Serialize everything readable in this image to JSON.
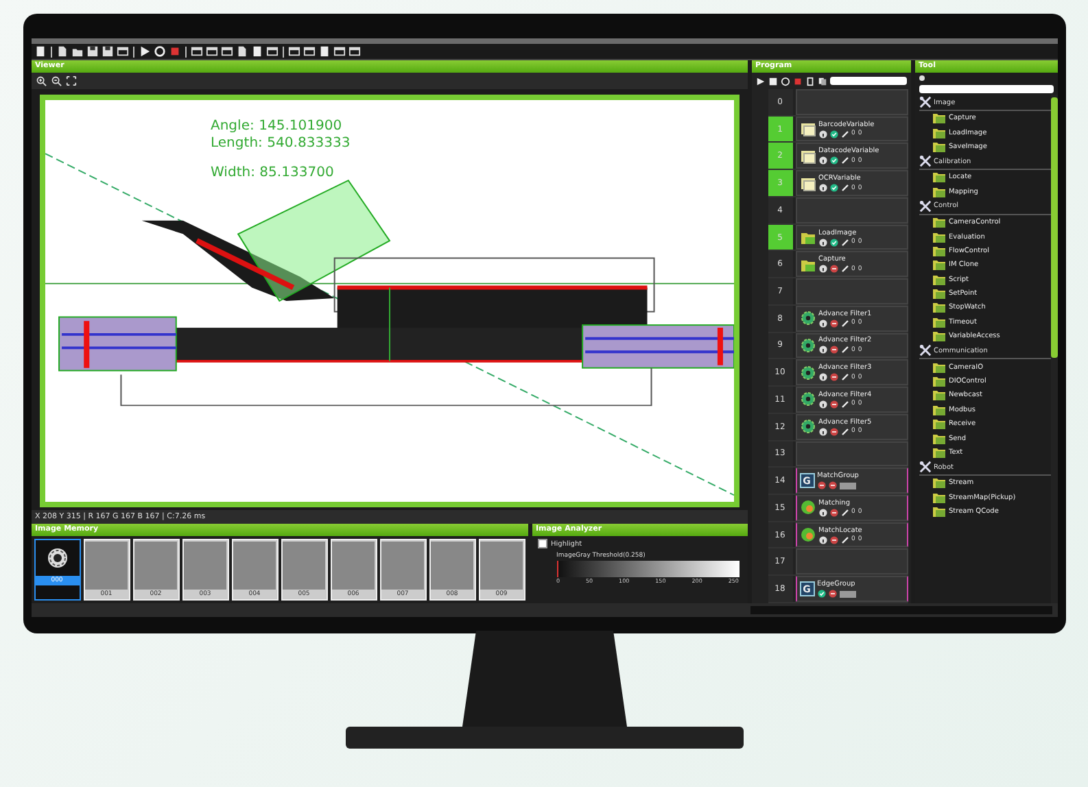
{
  "viewer": {
    "title": "Viewer",
    "measurements": [
      "Angle: 145.101900",
      "Length: 540.833333",
      "Width: 85.133700"
    ],
    "status": "X 208 Y 315 | R 167 G 167 B 167 | C:7.26 ms"
  },
  "image_memory": {
    "title": "Image Memory",
    "slots": [
      {
        "label": "000",
        "selected": true
      },
      {
        "label": "001",
        "selected": false
      },
      {
        "label": "002",
        "selected": false
      },
      {
        "label": "003",
        "selected": false
      },
      {
        "label": "004",
        "selected": false
      },
      {
        "label": "005",
        "selected": false
      },
      {
        "label": "006",
        "selected": false
      },
      {
        "label": "007",
        "selected": false
      },
      {
        "label": "008",
        "selected": false
      },
      {
        "label": "009",
        "selected": false
      }
    ]
  },
  "image_analyzer": {
    "title": "Image Analyzer",
    "highlight": {
      "label": "Highlight",
      "checked": false
    },
    "histogram_title": "ImageGray Threshold(0.258)",
    "axis_labels": [
      "0",
      "50",
      "100",
      "150",
      "200",
      "250"
    ]
  },
  "program": {
    "title": "Program",
    "rows": [
      {
        "number": "0",
        "highlighted": false,
        "in_group": false
      },
      {
        "number": "1",
        "highlighted": true,
        "in_group": false,
        "item": {
          "kind": "variable",
          "name": "BarcodeVariable",
          "enabled": true,
          "counts": [
            "0",
            "0"
          ]
        }
      },
      {
        "number": "2",
        "highlighted": true,
        "in_group": false,
        "item": {
          "kind": "variable",
          "name": "DatacodeVariable",
          "enabled": true,
          "counts": [
            "0",
            "0"
          ]
        }
      },
      {
        "number": "3",
        "highlighted": true,
        "in_group": false,
        "item": {
          "kind": "variable",
          "name": "OCRVariable",
          "enabled": true,
          "counts": [
            "0",
            "0"
          ]
        }
      },
      {
        "number": "4",
        "highlighted": false,
        "in_group": false
      },
      {
        "number": "5",
        "highlighted": true,
        "in_group": false,
        "item": {
          "kind": "image",
          "name": "LoadImage",
          "enabled": true,
          "counts": [
            "0",
            "0"
          ]
        }
      },
      {
        "number": "6",
        "highlighted": false,
        "in_group": false,
        "item": {
          "kind": "image",
          "name": "Capture",
          "enabled": false,
          "counts": [
            "0",
            "0"
          ]
        }
      },
      {
        "number": "7",
        "highlighted": false,
        "in_group": false
      },
      {
        "number": "8",
        "highlighted": false,
        "in_group": false,
        "item": {
          "kind": "filter",
          "name": "Advance Filter1",
          "enabled": false,
          "counts": [
            "0",
            "0"
          ]
        }
      },
      {
        "number": "9",
        "highlighted": false,
        "in_group": false,
        "item": {
          "kind": "filter",
          "name": "Advance Filter2",
          "enabled": false,
          "counts": [
            "0",
            "0"
          ]
        }
      },
      {
        "number": "10",
        "highlighted": false,
        "in_group": false,
        "item": {
          "kind": "filter",
          "name": "Advance Filter3",
          "enabled": false,
          "counts": [
            "0",
            "0"
          ]
        }
      },
      {
        "number": "11",
        "highlighted": false,
        "in_group": false,
        "item": {
          "kind": "filter",
          "name": "Advance Filter4",
          "enabled": false,
          "counts": [
            "0",
            "0"
          ]
        }
      },
      {
        "number": "12",
        "highlighted": false,
        "in_group": false,
        "item": {
          "kind": "filter",
          "name": "Advance Filter5",
          "enabled": false,
          "counts": [
            "0",
            "0"
          ]
        }
      },
      {
        "number": "13",
        "highlighted": false,
        "in_group": false
      },
      {
        "number": "14",
        "highlighted": false,
        "in_group": true,
        "item": {
          "kind": "group",
          "name": "MatchGroup",
          "badge": "G",
          "enabled": false
        }
      },
      {
        "number": "15",
        "highlighted": false,
        "in_group": true,
        "item": {
          "kind": "match",
          "name": "Matching",
          "enabled": false,
          "counts": [
            "0",
            "0"
          ]
        }
      },
      {
        "number": "16",
        "highlighted": false,
        "in_group": true,
        "item": {
          "kind": "match",
          "name": "MatchLocate",
          "enabled": false,
          "counts": [
            "0",
            "0"
          ]
        }
      },
      {
        "number": "17",
        "highlighted": false,
        "in_group": false
      },
      {
        "number": "18",
        "highlighted": false,
        "in_group": true,
        "item": {
          "kind": "group",
          "name": "EdgeGroup",
          "badge": "G",
          "enabled": true
        }
      }
    ]
  },
  "tool": {
    "title": "Tool",
    "categories": [
      {
        "name": "Image",
        "items": [
          "Capture",
          "LoadImage",
          "SaveImage"
        ]
      },
      {
        "name": "Calibration",
        "items": [
          "Locate",
          "Mapping"
        ]
      },
      {
        "name": "Control",
        "items": [
          "CameraControl",
          "Evaluation",
          "FlowControl",
          "IM Clone",
          "Script",
          "SetPoint",
          "StopWatch",
          "Timeout",
          "VariableAccess"
        ]
      },
      {
        "name": "Communication",
        "items": [
          "CameraIO",
          "DIOControl",
          "Newbcast",
          "Modbus",
          "Receive",
          "Send",
          "Text"
        ]
      },
      {
        "name": "Robot",
        "items": [
          "Stream",
          "StreamMap(Pickup)",
          "Stream QCode"
        ]
      }
    ]
  }
}
